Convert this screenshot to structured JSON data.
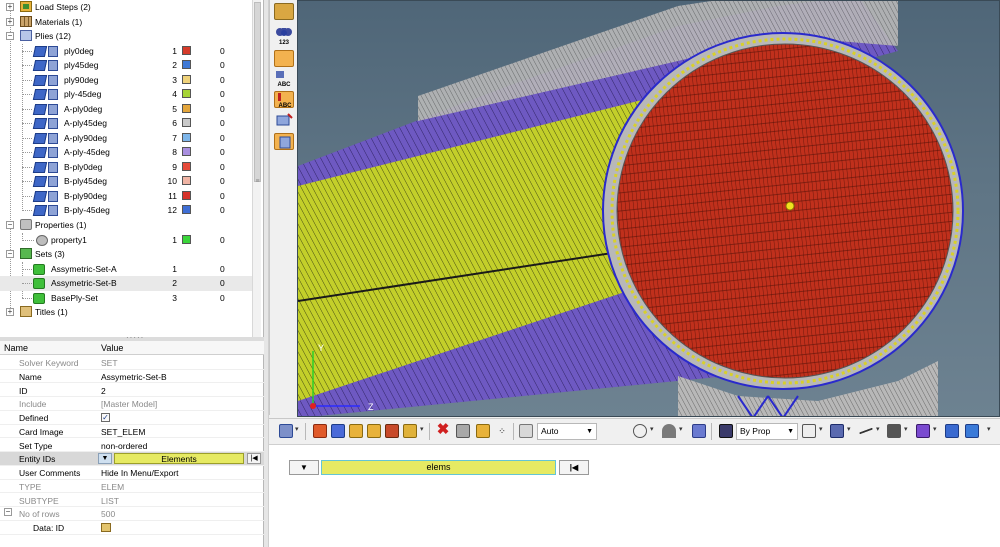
{
  "tree": {
    "groups": [
      {
        "label": "Load Steps (2)",
        "icon": "load-steps-icon"
      },
      {
        "label": "Materials (1)",
        "icon": "materials-icon"
      },
      {
        "label": "Plies (12)",
        "icon": "plies-icon"
      }
    ],
    "plies": [
      {
        "label": "ply0deg",
        "id": "1",
        "color": "#d63b2a",
        "value": "0"
      },
      {
        "label": "ply45deg",
        "id": "2",
        "color": "#3f79d6",
        "value": "0"
      },
      {
        "label": "ply90deg",
        "id": "3",
        "color": "#efd27a",
        "value": "0"
      },
      {
        "label": "ply-45deg",
        "id": "4",
        "color": "#a6d436",
        "value": "0"
      },
      {
        "label": "A-ply0deg",
        "id": "5",
        "color": "#e4a63b",
        "value": "0"
      },
      {
        "label": "A-ply45deg",
        "id": "6",
        "color": "#c9c9c9",
        "value": "0"
      },
      {
        "label": "A-ply90deg",
        "id": "7",
        "color": "#7eb6ea",
        "value": "0"
      },
      {
        "label": "A-ply-45deg",
        "id": "8",
        "color": "#a98fe0",
        "value": "0"
      },
      {
        "label": "B-ply0deg",
        "id": "9",
        "color": "#e64a3a",
        "value": "0"
      },
      {
        "label": "B-ply45deg",
        "id": "10",
        "color": "#f0b4a4",
        "value": "0"
      },
      {
        "label": "B-ply90deg",
        "id": "11",
        "color": "#d6322a",
        "value": "0"
      },
      {
        "label": "B-ply-45deg",
        "id": "12",
        "color": "#3f6fd6",
        "value": "0"
      }
    ],
    "properties": {
      "label": "Properties (1)",
      "item": {
        "label": "property1",
        "id": "1",
        "color": "#3ad63a",
        "value": "0"
      }
    },
    "sets": {
      "label": "Sets (3)",
      "items": [
        {
          "label": "Assymetric-Set-A",
          "id": "1",
          "value": "0"
        },
        {
          "label": "Assymetric-Set-B",
          "id": "2",
          "value": "0"
        },
        {
          "label": "BasePly-Set",
          "id": "3",
          "value": "0"
        }
      ]
    },
    "titles": {
      "label": "Titles (1)"
    }
  },
  "props": {
    "header_name": "Name",
    "header_value": "Value",
    "rows": [
      {
        "name": "Solver Keyword",
        "value": "SET",
        "gray": true
      },
      {
        "name": "Name",
        "value": "Assymetric-Set-B",
        "gray": false
      },
      {
        "name": "ID",
        "value": "2",
        "gray": false
      },
      {
        "name": "Include",
        "value": "[Master Model]",
        "gray": true
      },
      {
        "name": "Defined",
        "value": "",
        "gray": false,
        "check": true
      },
      {
        "name": "Card Image",
        "value": "SET_ELEM",
        "gray": false
      },
      {
        "name": "Set Type",
        "value": "non-ordered",
        "gray": false
      }
    ],
    "entity_ids": {
      "name": "Entity IDs",
      "value": "Elements"
    },
    "rows2": [
      {
        "name": "User Comments",
        "value": "Hide In Menu/Export",
        "gray": false
      },
      {
        "name": "TYPE",
        "value": "ELEM",
        "gray": true
      },
      {
        "name": "SUBTYPE",
        "value": "LIST",
        "gray": true
      }
    ],
    "no_of_rows": {
      "name": "No of rows",
      "value": "500"
    },
    "data_id": {
      "name": "Data: ID"
    }
  },
  "viewport": {
    "axis_y": "Y",
    "axis_z": "Z",
    "colors": {
      "face": "#c0301c",
      "yellow": "#c3cf2a",
      "purple": "#6e59c2",
      "gray": "#b8b8b8"
    }
  },
  "toolbar": {
    "auto_label": "Auto",
    "byprop_label": "By Prop"
  },
  "bottom": {
    "field_label": "elems"
  }
}
